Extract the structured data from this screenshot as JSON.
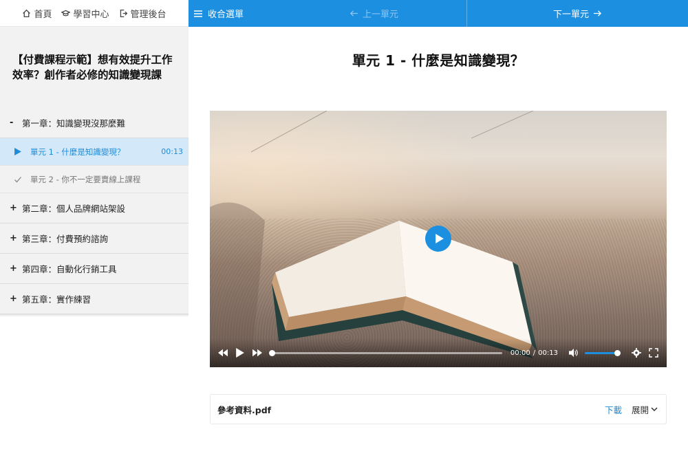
{
  "sidebar": {
    "nav": [
      {
        "label": "首頁",
        "icon": "home-icon"
      },
      {
        "label": "學習中心",
        "icon": "graduation-cap-icon"
      },
      {
        "label": "管理後台",
        "icon": "sign-out-icon"
      }
    ],
    "course_title": "【付費課程示範】想有效提升工作效率？創作者必修的知識變現課",
    "chapters": [
      {
        "sign": "-",
        "label": "第一章：知識變現沒那麼難",
        "units": [
          {
            "label": "單元 1 - 什麼是知識變現？",
            "duration": "00:13",
            "active": true
          },
          {
            "label": "單元 2 - 你不一定要賣線上課程",
            "duration": "",
            "active": false
          }
        ]
      },
      {
        "sign": "+",
        "label": "第二章：個人品牌網站架設"
      },
      {
        "sign": "+",
        "label": "第三章：付費預約諮詢"
      },
      {
        "sign": "+",
        "label": "第四章：自動化行銷工具"
      },
      {
        "sign": "+",
        "label": "第五章：實作練習"
      }
    ]
  },
  "topbar": {
    "menu_label": "收合選單",
    "prev_label": "上一單元",
    "next_label": "下一單元",
    "accent": "#1d8fe1"
  },
  "main": {
    "unit_title": "單元 1 - 什麼是知識變現？",
    "video": {
      "current_time": "00:00",
      "separator": "/",
      "total_time": "00:13",
      "progress": 0,
      "volume": 1.0
    },
    "attachment": {
      "file_name": "參考資料.pdf",
      "download_label": "下載",
      "expand_label": "展開"
    }
  }
}
